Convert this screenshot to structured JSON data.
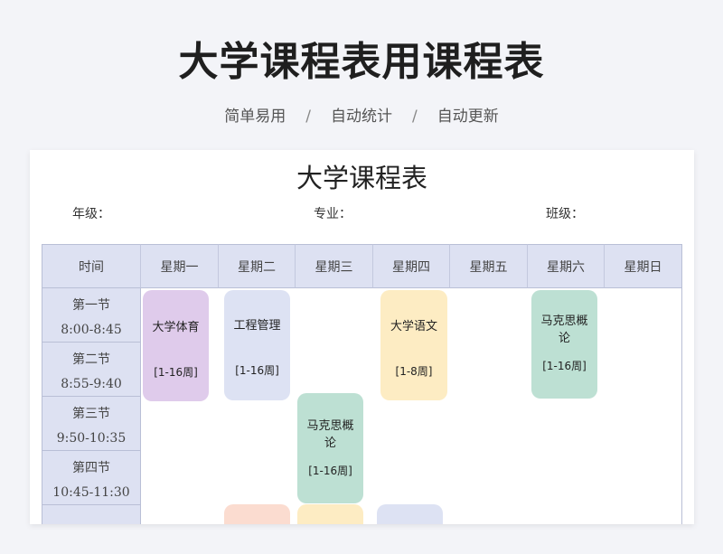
{
  "header": {
    "title": "大学课程表用课程表",
    "features": [
      "简单易用",
      "自动统计",
      "自动更新"
    ],
    "separator": "/"
  },
  "document": {
    "title": "大学课程表",
    "grade_label": "年级：",
    "major_label": "专业：",
    "class_label": "班级："
  },
  "table": {
    "time_header": "时间",
    "days": [
      "星期一",
      "星期二",
      "星期三",
      "星期四",
      "星期五",
      "星期六",
      "星期日"
    ],
    "periods": [
      {
        "name": "第一节",
        "time": "8:00-8:45"
      },
      {
        "name": "第二节",
        "time": "8:55-9:40"
      },
      {
        "name": "第三节",
        "time": "9:50-10:35"
      },
      {
        "name": "第四节",
        "time": "10:45-11:30"
      }
    ],
    "courses": [
      {
        "name": "大学体育",
        "weeks": "[1-16周]",
        "day": "星期一",
        "color": "#dfcbeb"
      },
      {
        "name": "工程管理",
        "weeks": "[1-16周]",
        "day": "星期二",
        "color": "#dde2f3"
      },
      {
        "name": "大学语文",
        "weeks": "[1-8周]",
        "day": "星期四",
        "color": "#fdecc3"
      },
      {
        "name": "马克思概论",
        "weeks": "[1-16周]",
        "day": "星期六",
        "color": "#bde0d3"
      },
      {
        "name": "马克思概论",
        "weeks": "[1-16周]",
        "day": "星期三",
        "color": "#bde0d3"
      }
    ],
    "partial_colors": [
      "#fbdcd0",
      "#fdecc3",
      "#dde2f3"
    ]
  }
}
